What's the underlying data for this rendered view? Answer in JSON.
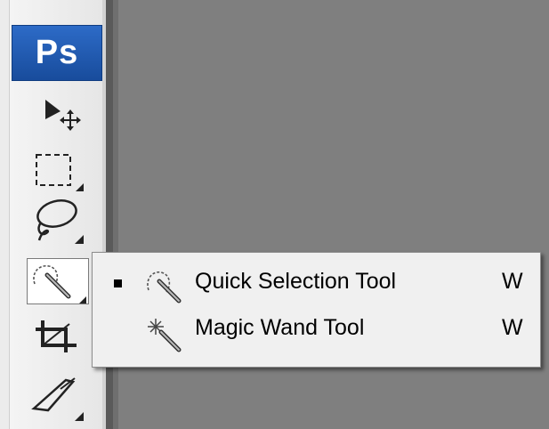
{
  "toolbar": {
    "logo_text": "Ps",
    "tools": [
      {
        "name": "move-tool",
        "icon": "move-icon"
      },
      {
        "name": "marquee-tool",
        "icon": "rectangle-marquee-icon"
      },
      {
        "name": "lasso-tool",
        "icon": "lasso-icon"
      },
      {
        "name": "quick-selection-tool",
        "icon": "quick-selection-icon",
        "active": true
      },
      {
        "name": "crop-tool",
        "icon": "crop-icon"
      },
      {
        "name": "slice-tool",
        "icon": "slice-icon"
      }
    ]
  },
  "flyout": {
    "items": [
      {
        "label": "Quick Selection Tool",
        "shortcut": "W",
        "selected": true,
        "icon": "quick-selection-icon"
      },
      {
        "label": "Magic Wand Tool",
        "shortcut": "W",
        "selected": false,
        "icon": "magic-wand-icon"
      }
    ]
  },
  "colors": {
    "canvas_bg": "#7f7f7f",
    "toolbar_bg": "#ececec",
    "ps_logo_bg": "#1f5db5",
    "menu_bg": "#f0f0f0"
  }
}
